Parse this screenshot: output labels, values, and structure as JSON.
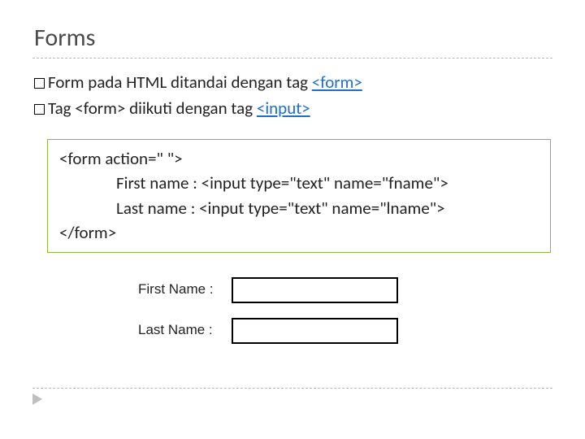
{
  "title": "Forms",
  "bullets": {
    "b1_prefix": "Form pada HTML ditandai dengan tag ",
    "b1_tag": "<form>",
    "b2_prefix": "Tag ",
    "b2_mid": "<form>",
    "b2_text": " diikuti dengan tag ",
    "b2_tag": "<input>"
  },
  "code": {
    "l1": "<form action=\" \">",
    "l2": "First name : <input type=\"text\" name=\"fname\">",
    "l3": "Last name : <input type=\"text\" name=\"lname\">",
    "l4": "</form>"
  },
  "demo": {
    "label1": "First Name :",
    "label2": "Last Name :"
  }
}
